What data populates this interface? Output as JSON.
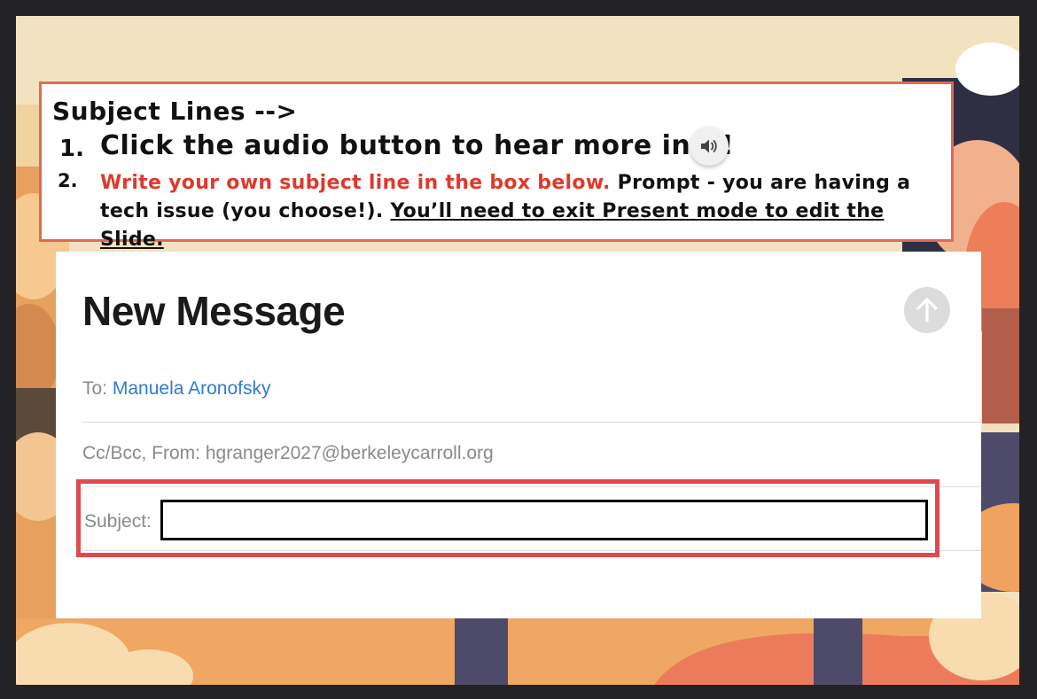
{
  "instructions": {
    "title": "Subject Lines -->",
    "item1_number": "1.",
    "item1_text": "Click the audio button to hear more info!",
    "item2_number": "2.",
    "item2_red_text": "Write your own subject line in the box below.",
    "item2_text": " Prompt - you are having a tech issue (you choose!). ",
    "item2_underlined_text": "You’ll need to exit Present mode to edit the Slide."
  },
  "audio_button": {
    "icon": "speaker-icon"
  },
  "email": {
    "heading": "New Message",
    "send_icon": "arrow-up-icon",
    "to_label": "To:",
    "to_name": "Manuela Aronofsky",
    "cc_label": "Cc/Bcc, From:",
    "from_address": "hgranger2027@berkeleycarroll.org",
    "subject_label": "Subject:",
    "subject_value": ""
  },
  "colors": {
    "accent_red": "#e0392b",
    "frame_red": "#e04a4f",
    "link_blue": "#2f7bd3",
    "instr_border": "#e06a55"
  }
}
